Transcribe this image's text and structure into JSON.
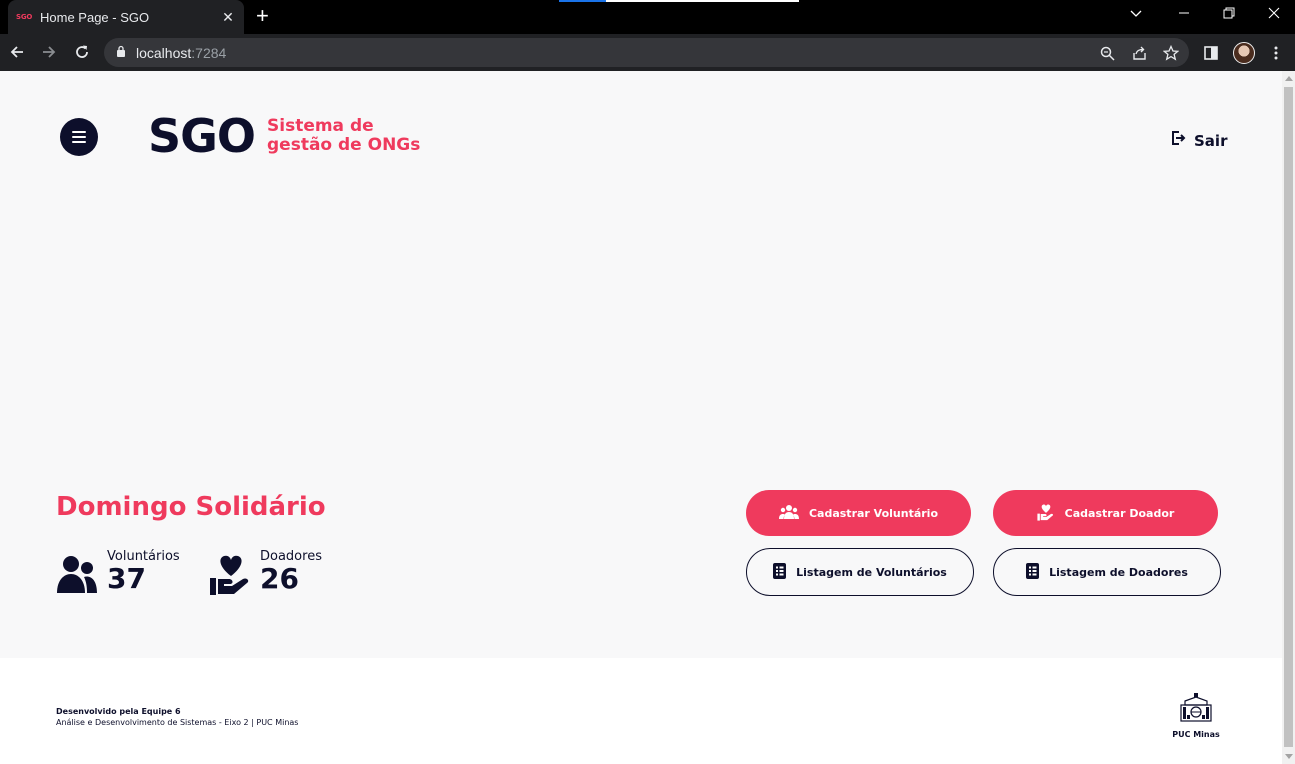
{
  "browser": {
    "tab_title": "Home Page - SGO",
    "favicon_text": "SGO",
    "url_host": "localhost",
    "url_port": ":7284"
  },
  "header": {
    "logo_mark": "SGO",
    "logo_line1": "Sistema de",
    "logo_line2": "gestão de ONGs",
    "logout_label": "Sair"
  },
  "event": {
    "title": "Domingo Solidário",
    "stats": [
      {
        "label": "Voluntários",
        "value": "37",
        "icon": "users-icon"
      },
      {
        "label": "Doadores",
        "value": "26",
        "icon": "hand-heart-icon"
      }
    ]
  },
  "actions": {
    "register_volunteer": "Cadastrar Voluntário",
    "register_donor": "Cadastrar Doador",
    "list_volunteers": "Listagem de Voluntários",
    "list_donors": "Listagem de Doadores"
  },
  "footer": {
    "team": "Desenvolvido pela Equipe 6",
    "course": "Análise e Desenvolvimento de Sistemas - Eixo 2 | PUC Minas",
    "institution": "PUC Minas"
  },
  "colors": {
    "brand_red": "#ef3a5d",
    "navy": "#0d0f2b"
  }
}
